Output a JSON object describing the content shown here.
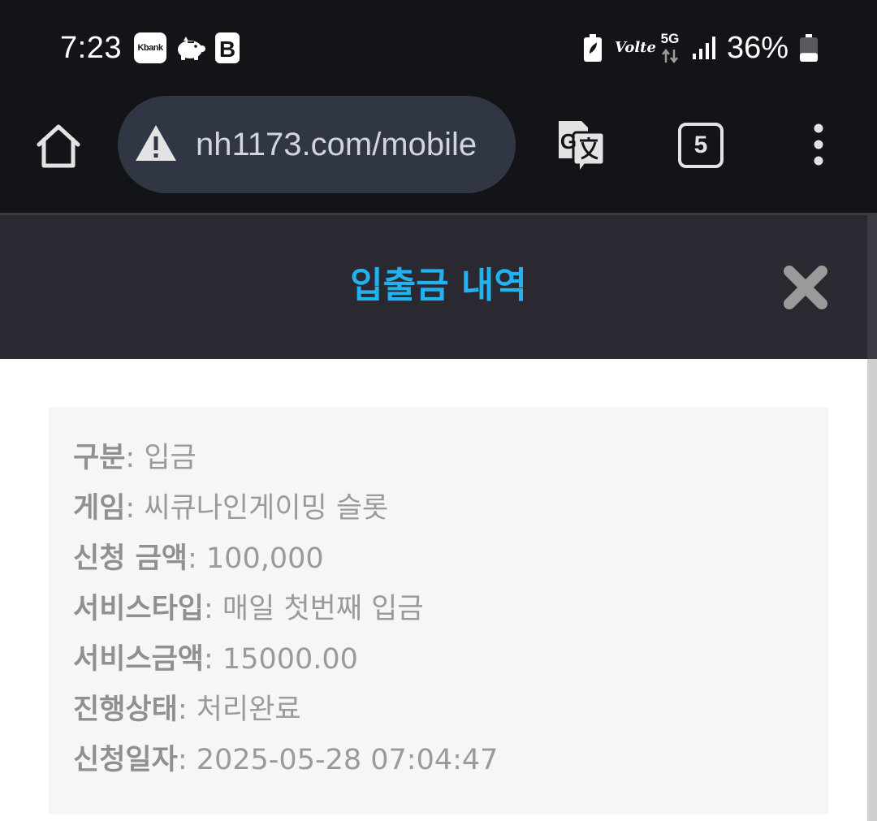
{
  "status_bar": {
    "time": "7:23",
    "kbank_label": "Kbank",
    "b_label": "B",
    "volte_label": "Volte",
    "network_label": "5G",
    "battery_percent": "36%",
    "battery_level": 0.36
  },
  "browser": {
    "url": "nh1173.com/mobile",
    "tab_count": "5"
  },
  "modal": {
    "title": "입출금 내역"
  },
  "details": [
    {
      "label": "구분",
      "value": ": 입금"
    },
    {
      "label": "게임",
      "value": ": 씨큐나인게이밍 슬롯"
    },
    {
      "label": "신청 금액",
      "value": ": 100,000"
    },
    {
      "label": "서비스타입",
      "value": ": 매일 첫번째 입금"
    },
    {
      "label": "서비스금액",
      "value": ": 15000.00"
    },
    {
      "label": "진행상태",
      "value": ": 처리완료"
    },
    {
      "label": "신청일자",
      "value": ": 2025-05-28 07:04:47"
    }
  ],
  "colors": {
    "title": "#21b3f0",
    "header_bg": "#2a2831",
    "card_bg": "#f6f6f6",
    "text_gray": "#9a9a9a"
  }
}
